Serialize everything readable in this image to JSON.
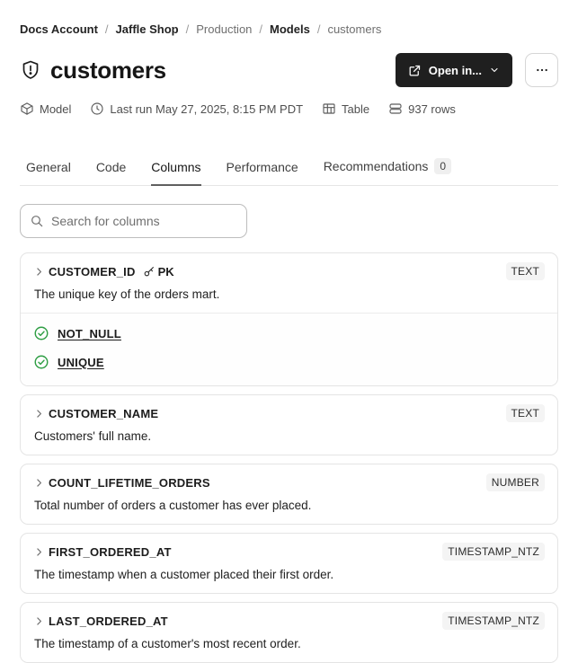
{
  "breadcrumb": {
    "separator": "/",
    "items": [
      {
        "label": "Docs Account",
        "muted": false
      },
      {
        "label": "Jaffle Shop",
        "muted": false
      },
      {
        "label": "Production",
        "muted": true
      },
      {
        "label": "Models",
        "muted": false
      },
      {
        "label": "customers",
        "muted": true
      }
    ]
  },
  "header": {
    "title": "customers",
    "open_in_label": "Open in..."
  },
  "meta": {
    "resource_type": "Model",
    "last_run": "Last run May 27, 2025, 8:15 PM PDT",
    "materialization": "Table",
    "row_count": "937 rows"
  },
  "tabs": {
    "items": [
      {
        "label": "General"
      },
      {
        "label": "Code"
      },
      {
        "label": "Columns"
      },
      {
        "label": "Performance"
      },
      {
        "label": "Recommendations",
        "badge": "0"
      }
    ],
    "active": "Columns"
  },
  "search": {
    "placeholder": "Search for columns"
  },
  "columns": [
    {
      "name": "CUSTOMER_ID",
      "pk_label": "PK",
      "type": "TEXT",
      "description": "The unique key of the orders mart.",
      "tests": [
        "NOT_NULL",
        "UNIQUE"
      ]
    },
    {
      "name": "CUSTOMER_NAME",
      "type": "TEXT",
      "description": "Customers' full name."
    },
    {
      "name": "COUNT_LIFETIME_ORDERS",
      "type": "NUMBER",
      "description": "Total number of orders a customer has ever placed."
    },
    {
      "name": "FIRST_ORDERED_AT",
      "type": "TIMESTAMP_NTZ",
      "description": "The timestamp when a customer placed their first order."
    },
    {
      "name": "LAST_ORDERED_AT",
      "type": "TIMESTAMP_NTZ",
      "description": "The timestamp of a customer's most recent order."
    }
  ],
  "colors": {
    "primary_button_bg": "#1f1f1f",
    "test_pass_green": "#2f9e44",
    "type_badge_bg": "#f4f4f4",
    "card_border": "#e4e4e4",
    "muted_text": "#6f6f6f"
  }
}
